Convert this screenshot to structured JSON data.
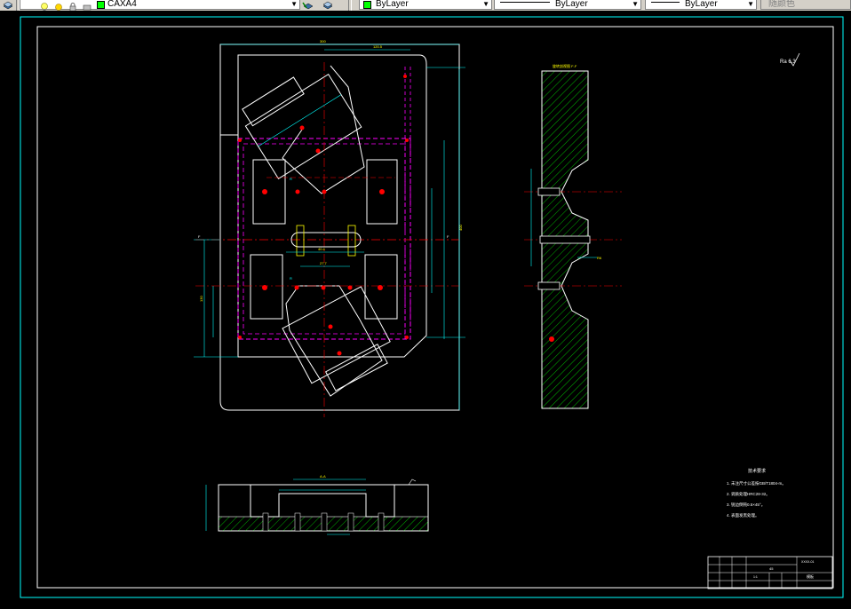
{
  "toolbar": {
    "layer_name": "CAXA4",
    "color_value": "ByLayer",
    "linetype_value": "ByLayer",
    "lineweight_value": "ByLayer",
    "plotstyle_value": "随颜色"
  },
  "drawing": {
    "roughness_mark": "Ra 6.3",
    "section_label": "旋转剖视图 F-F",
    "bottom_view_label": "A-A",
    "notes_title": "技术要求",
    "notes": [
      "1. 未注尺寸公差按GB/T1804-m。",
      "2. 调质处理HRC28-32。",
      "3. 锐边倒钝0.5×45°。",
      "4. 表面发黑处理。"
    ],
    "title_block": {
      "material": "45",
      "drawing_number": "XXXX-01",
      "name": "模板",
      "scale": "1:1"
    },
    "colors": {
      "outline": "#ffffff",
      "dimension": "#00ffff",
      "hidden_line": "#ff00ff",
      "centerline": "#ff0000",
      "hatch": "#00ff00",
      "text": "#ffff00",
      "border": "#00ffff"
    }
  }
}
